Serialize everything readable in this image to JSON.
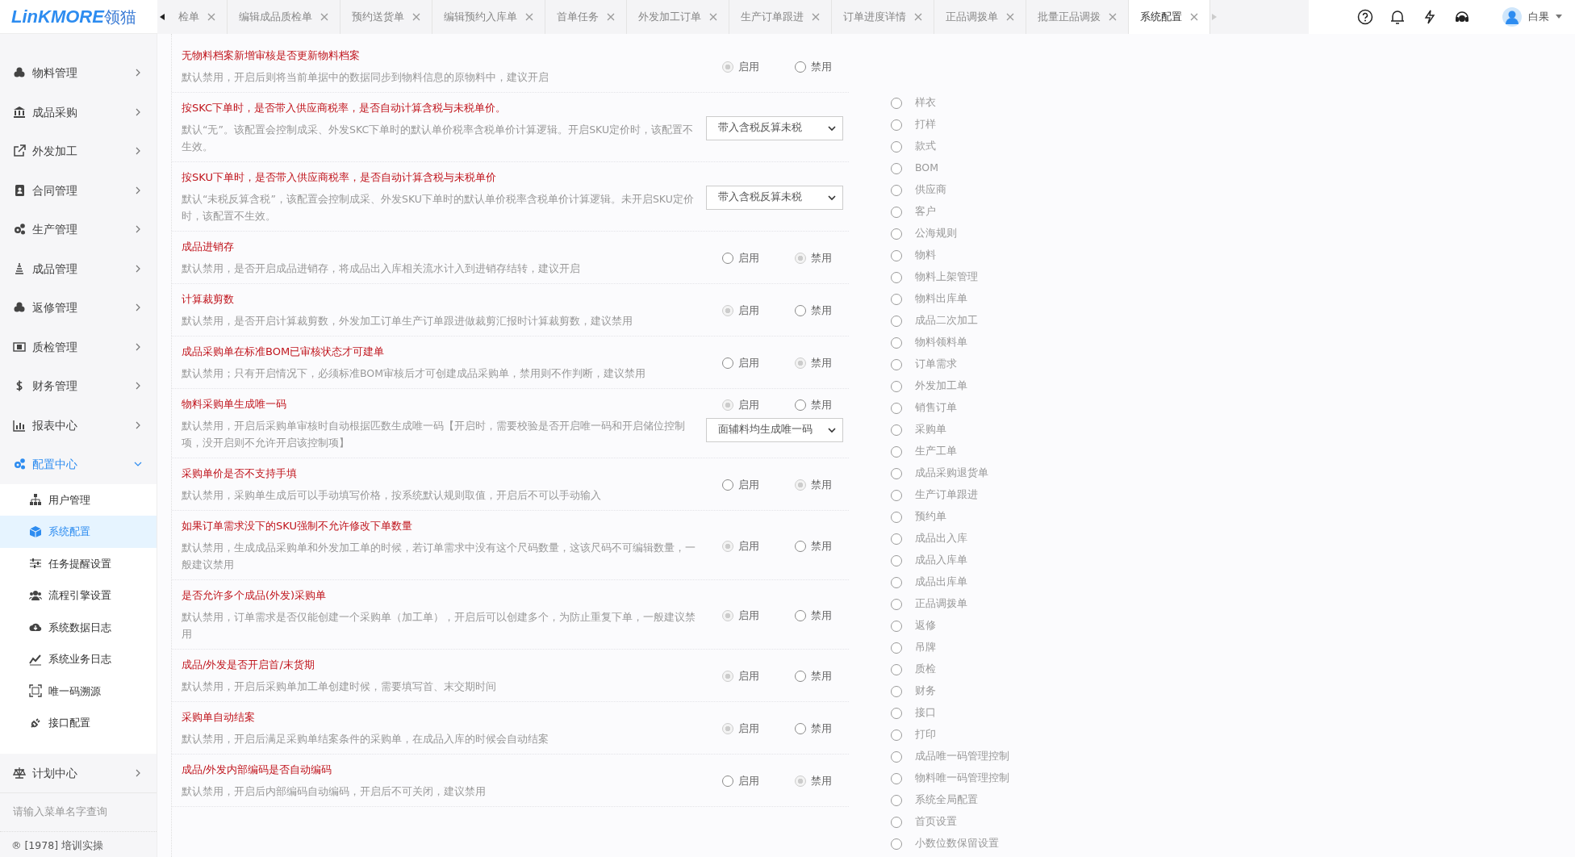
{
  "header": {
    "logo": "LinKMORE",
    "logo_suffix": "领猫",
    "tabs": [
      {
        "label": "检单",
        "selected": false
      },
      {
        "label": "编辑成品质检单",
        "selected": false
      },
      {
        "label": "预约送货单",
        "selected": false
      },
      {
        "label": "编辑预约入库单",
        "selected": false
      },
      {
        "label": "首单任务",
        "selected": false
      },
      {
        "label": "外发加工订单",
        "selected": false
      },
      {
        "label": "生产订单跟进",
        "selected": false
      },
      {
        "label": "订单进度详情",
        "selected": false
      },
      {
        "label": "正品调拨单",
        "selected": false
      },
      {
        "label": "批量正品调拨",
        "selected": false
      },
      {
        "label": "系统配置",
        "selected": true
      }
    ],
    "user": {
      "name": "白果"
    }
  },
  "sidebar": {
    "items": [
      {
        "label": "物料管理",
        "expanded": false
      },
      {
        "label": "成品采购",
        "expanded": false
      },
      {
        "label": "外发加工",
        "expanded": false
      },
      {
        "label": "合同管理",
        "expanded": false
      },
      {
        "label": "生产管理",
        "expanded": false
      },
      {
        "label": "成品管理",
        "expanded": false
      },
      {
        "label": "返修管理",
        "expanded": false
      },
      {
        "label": "质检管理",
        "expanded": false
      },
      {
        "label": "财务管理",
        "expanded": false
      },
      {
        "label": "报表中心",
        "expanded": false
      },
      {
        "label": "配置中心",
        "expanded": true,
        "children": [
          {
            "label": "用户管理",
            "selected": false
          },
          {
            "label": "系统配置",
            "selected": true
          },
          {
            "label": "任务提醒设置",
            "selected": false
          },
          {
            "label": "流程引擎设置",
            "selected": false
          },
          {
            "label": "系统数据日志",
            "selected": false
          },
          {
            "label": "系统业务日志",
            "selected": false
          },
          {
            "label": "唯一码溯源",
            "selected": false
          },
          {
            "label": "接口配置",
            "selected": false
          }
        ]
      },
      {
        "label": "计划中心",
        "expanded": false
      }
    ],
    "search": {
      "placeholder": "请输入菜单名字查询"
    },
    "footer": "® [1978] 培训实操"
  },
  "settings": [
    {
      "kind": "radio",
      "title": "无物料档案新增审核是否更新物料档案",
      "description": "默认禁用，开启后则将当前单据中的数据同步到物料信息的原物料中，建议开启",
      "options": [
        {
          "label": "启用",
          "selected": true
        },
        {
          "label": "禁用",
          "selected": false
        }
      ]
    },
    {
      "kind": "select",
      "title": "按SKC下单时，是否带入供应商税率，是否自动计算含税与未税单价。",
      "description": "默认“无”。该配置会控制成采、外发SKC下单时的默认单价税率含税单价计算逻辑。开启SKU定价时，该配置不生效。",
      "value": "带入含税反算未税"
    },
    {
      "kind": "select",
      "title": "按SKU下单时，是否带入供应商税率，是否自动计算含税与未税单价",
      "description": "默认“未税反算含税”，该配置会控制成采、外发SKU下单时的默认单价税率含税单价计算逻辑。未开启SKU定价时，该配置不生效。",
      "value": "带入含税反算未税"
    },
    {
      "kind": "radio",
      "title": "成品进销存",
      "description": "默认禁用，是否开启成品进销存，将成品出入库相关流水计入到进销存结转，建议开启",
      "options": [
        {
          "label": "启用",
          "selected": false
        },
        {
          "label": "禁用",
          "selected": true
        }
      ]
    },
    {
      "kind": "radio",
      "title": "计算裁剪数",
      "description": "默认禁用，是否开启计算裁剪数，外发加工订单生产订单跟进做裁剪汇报时计算裁剪数，建议禁用",
      "options": [
        {
          "label": "启用",
          "selected": true
        },
        {
          "label": "禁用",
          "selected": false
        }
      ]
    },
    {
      "kind": "radio",
      "title": "成品采购单在标准BOM已审核状态才可建单",
      "description": "默认禁用；只有开启情况下，必须标准BOM审核后才可创建成品采购单，禁用则不作判断，建议禁用",
      "options": [
        {
          "label": "启用",
          "selected": false
        },
        {
          "label": "禁用",
          "selected": true
        }
      ]
    },
    {
      "kind": "radio_select",
      "title": "物料采购单生成唯一码",
      "description": "默认禁用，开启后采购单审核时自动根据匹数生成唯一码【开启时，需要校验是否开启唯一码和开启储位控制项，没开启则不允许开启该控制项】",
      "options": [
        {
          "label": "启用",
          "selected": true
        },
        {
          "label": "禁用",
          "selected": false
        }
      ],
      "value": "面辅料均生成唯一码"
    },
    {
      "kind": "radio",
      "title": "采购单价是否不支持手填",
      "description": "默认禁用，采购单生成后可以手动填写价格，按系统默认规则取值，开启后不可以手动输入",
      "options": [
        {
          "label": "启用",
          "selected": false
        },
        {
          "label": "禁用",
          "selected": true
        }
      ]
    },
    {
      "kind": "radio",
      "title": "如果订单需求没下的SKU强制不允许修改下单数量",
      "description": "默认禁用，生成成品采购单和外发加工单的时候，若订单需求中没有这个尺码数量，这该尺码不可编辑数量，一般建议禁用",
      "options": [
        {
          "label": "启用",
          "selected": true
        },
        {
          "label": "禁用",
          "selected": false
        }
      ]
    },
    {
      "kind": "radio",
      "title": "是否允许多个成品(外发)采购单",
      "description": "默认禁用，订单需求是否仅能创建一个采购单（加工单），开启后可以创建多个，为防止重复下单，一般建议禁用",
      "options": [
        {
          "label": "启用",
          "selected": true
        },
        {
          "label": "禁用",
          "selected": false
        }
      ]
    },
    {
      "kind": "radio",
      "title": "成品/外发是否开启首/末货期",
      "description": "默认禁用，开启后采购单加工单创建时候，需要填写首、末交期时间",
      "options": [
        {
          "label": "启用",
          "selected": true
        },
        {
          "label": "禁用",
          "selected": false
        }
      ]
    },
    {
      "kind": "radio",
      "title": "采购单自动结案",
      "description": "默认禁用，开启后满足采购单结案条件的采购单，在成品入库的时候会自动结案",
      "options": [
        {
          "label": "启用",
          "selected": true
        },
        {
          "label": "禁用",
          "selected": false
        }
      ]
    },
    {
      "kind": "radio",
      "title": "成品/外发内部编码是否自动编码",
      "description": "默认禁用，开启后内部编码自动编码，开启后不可关闭，建议禁用",
      "options": [
        {
          "label": "启用",
          "selected": false
        },
        {
          "label": "禁用",
          "selected": true
        }
      ]
    }
  ],
  "section_list": {
    "items": [
      {
        "label": "样衣",
        "selected": false
      },
      {
        "label": "打样",
        "selected": false
      },
      {
        "label": "款式",
        "selected": false
      },
      {
        "label": "BOM",
        "selected": false
      },
      {
        "label": "供应商",
        "selected": false
      },
      {
        "label": "客户",
        "selected": false
      },
      {
        "label": "公海规则",
        "selected": false
      },
      {
        "label": "物料",
        "selected": false
      },
      {
        "label": "物料上架管理",
        "selected": false
      },
      {
        "label": "物料出库单",
        "selected": false
      },
      {
        "label": "成品二次加工",
        "selected": false
      },
      {
        "label": "物料领料单",
        "selected": false
      },
      {
        "label": "订单需求",
        "selected": false
      },
      {
        "label": "外发加工单",
        "selected": false
      },
      {
        "label": "销售订单",
        "selected": false
      },
      {
        "label": "采购单",
        "selected": false
      },
      {
        "label": "生产工单",
        "selected": false
      },
      {
        "label": "成品采购退货单",
        "selected": false
      },
      {
        "label": "生产订单跟进",
        "selected": false
      },
      {
        "label": "预约单",
        "selected": false
      },
      {
        "label": "成品出入库",
        "selected": false
      },
      {
        "label": "成品入库单",
        "selected": false
      },
      {
        "label": "成品出库单",
        "selected": false
      },
      {
        "label": "正品调拨单",
        "selected": false
      },
      {
        "label": "返修",
        "selected": false
      },
      {
        "label": "吊牌",
        "selected": false
      },
      {
        "label": "质检",
        "selected": false
      },
      {
        "label": "财务",
        "selected": false
      },
      {
        "label": "接口",
        "selected": false
      },
      {
        "label": "打印",
        "selected": false
      },
      {
        "label": "成品唯一码管理控制",
        "selected": false
      },
      {
        "label": "物料唯一码管理控制",
        "selected": false
      },
      {
        "label": "系统全局配置",
        "selected": false
      },
      {
        "label": "首页设置",
        "selected": false
      },
      {
        "label": "小数位数保留设置",
        "selected": false
      }
    ]
  }
}
